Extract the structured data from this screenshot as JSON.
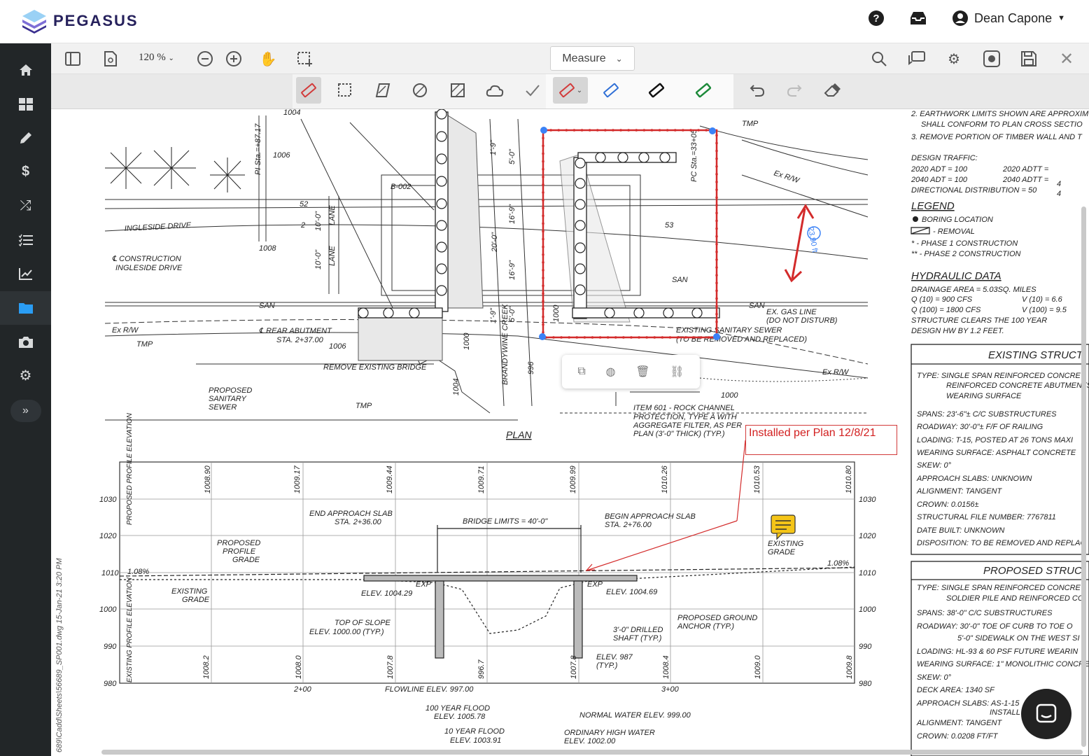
{
  "app": {
    "name": "PEGASUS",
    "user": "Dean Capone"
  },
  "sidebar": {
    "items": [
      "home-icon",
      "dashboard-icon",
      "pencil-icon",
      "dollar-icon",
      "shuffle-icon",
      "checklist-icon",
      "chart-icon",
      "folder-icon",
      "camera-icon",
      "gear-icon"
    ],
    "active": "folder-icon"
  },
  "toolbar": {
    "zoom": "120 %",
    "mode": "Measure"
  },
  "annotation": {
    "note_text": "Installed per Plan 12/8/21",
    "measure_label": "23.90 ft"
  },
  "drawing": {
    "file_path": "689\\Cadd\\Sheets\\56689_SP001.dwg  15-Jan-21  3:20 PM",
    "plan_title": "PLAN",
    "plan_labels": {
      "sta_1004": "1004",
      "pi_sta": "PI Sta.=+87.17",
      "label_1006": "1006",
      "b002": "B-002",
      "ingleside": "INGLESIDE DRIVE",
      "label_1008": "1008",
      "construction": "℄ CONSTRUCTION",
      "ingleside2": "INGLESIDE DRIVE",
      "pc_sta": "PC Sta.=33+05",
      "tmp": "TMP",
      "exrw": "Ex R/W",
      "san": "SAN",
      "lane": "LANE",
      "rear_abutment": "℄ REAR ABUTMENT",
      "rear_sta": "STA. 2+37.00",
      "remove_bridge": "REMOVE EXISTING BRIDGE",
      "proposed_sanitary": "PROPOSED",
      "sanitary2": "SANITARY",
      "sewer": "SEWER",
      "gas_line": "EX. GAS LINE",
      "gas_note": "(DO NOT DISTURB)",
      "existing_sewer": "EXISTING SANITARY SEWER",
      "sewer_note": "(TO BE REMOVED AND REPLACED)",
      "brandywine": "BRANDYWINE CREEK",
      "item601": "ITEM 601 - ROCK CHANNEL",
      "item601b": "PROTECTION, TYPE A WITH",
      "item601c": "AGGREGATE FILTER, AS PER",
      "item601d": "PLAN (3'-0\" THICK) (TYP.)",
      "l1000": "1000",
      "l996": "996",
      "l53": "53",
      "l52": "52",
      "l2": "2",
      "dim_10_0": "10'-0\"",
      "dim_20_0": "20'-0\"",
      "dim_16_9": "16'-9\"",
      "dim_5_0": "5'-0\"",
      "dim_1_9": "1'-9\""
    },
    "profile": {
      "top_values": [
        "1008.90",
        "1009.17",
        "1009.44",
        "1009.71",
        "1009.99",
        "1010.26",
        "1010.53",
        "1010.80"
      ],
      "bottom_values": [
        "1008.2",
        "1008.0",
        "1007.8",
        "996.7",
        "1007.8",
        "1008.4",
        "1009.0",
        "1009.8"
      ],
      "elev_left": [
        "1030",
        "1020",
        "1010",
        "1000",
        "990",
        "980"
      ],
      "elev_right": [
        "1030",
        "1020",
        "1010",
        "1000",
        "990",
        "980"
      ],
      "stations": [
        "2+00",
        "3+00"
      ],
      "prop_label": "PROPOSED PROFILE ELEVATION",
      "exist_label": "EXISTING PROFILE ELEVATION",
      "end_slab": "END APPROACH SLAB",
      "end_slab_sta": "STA. 2+36.00",
      "begin_slab": "BEGIN APPROACH SLAB",
      "begin_slab_sta": "STA. 2+76.00",
      "bridge_limits": "BRIDGE LIMITS = 40'-0\"",
      "prop_grade": "PROPOSED",
      "prop_grade2": "PROFILE",
      "prop_grade3": "GRADE",
      "exist_grade": "EXISTING",
      "exist_grade2": "GRADE",
      "grade_left": "1.08%",
      "grade_right": "1.08%",
      "exp1": "EXP",
      "exp2": "EXP",
      "elev_1004_29": "ELEV. 1004.29",
      "elev_1004_69": "ELEV. 1004.69",
      "top_slope": "TOP OF SLOPE",
      "top_slope2": "ELEV. 1000.00 (TYP.)",
      "ground_anchor": "PROPOSED GROUND",
      "ground_anchor2": "ANCHOR (TYP.)",
      "drilled": "3'-0\" DRILLED",
      "drilled2": "SHAFT (TYP.)",
      "elev987": "ELEV. 987",
      "elev987b": "(TYP.)",
      "flowline": "FLOWLINE ELEV. 997.00",
      "flood100": "100 YEAR FLOOD",
      "flood100b": "ELEV. 1005.78",
      "normal_water": "NORMAL WATER ELEV. 999.00",
      "flood10": "10 YEAR FLOOD",
      "flood10b": "ELEV. 1003.91",
      "ohw": "ORDINARY HIGH WATER",
      "ohw2": "ELEV. 1002.00"
    },
    "notes": {
      "n2": "2. EARTHWORK LIMITS SHOWN ARE APPROXIM",
      "n2b": "SHALL CONFORM TO PLAN CROSS SECTIO",
      "n3": "3. REMOVE PORTION OF TIMBER WALL AND T",
      "design_traffic": "DESIGN TRAFFIC:",
      "adt2020": "2020 ADT = 100",
      "adtt2020": "2020 ADTT =",
      "adt2040": "2040 ADT = 100",
      "adtt2040": "2040 ADTT =",
      "dd": "DIRECTIONAL DISTRIBUTION = 50",
      "four1": "4",
      "four2": "4",
      "legend": "LEGEND",
      "boring": "BORING LOCATION",
      "removal": "- REMOVAL",
      "phase1": "* - PHASE 1 CONSTRUCTION",
      "phase2": "** - PHASE 2 CONSTRUCTION",
      "hydraulic": "HYDRAULIC DATA",
      "drainage": "DRAINAGE AREA = 5.03SQ. MILES",
      "q10": "Q (10) = 900 CFS",
      "v10": "V (10) = 6.6",
      "q100": "Q (100) = 1800 CFS",
      "v100": "V (100) = 9.5",
      "clears": "STRUCTURE CLEARS THE 100 YEAR",
      "design_hw": "DESIGN HW BY 1.2 FEET.",
      "existing_struct": "EXISTING STRUCT",
      "e_type": "TYPE: SINGLE SPAN REINFORCED CONCRET",
      "e_type2": "REINFORCED CONCRETE ABUTMENTS",
      "e_type3": "WEARING SURFACE",
      "e_spans": "SPANS: 23'-6\"± C/C SUBSTRUCTURES",
      "e_roadway": "ROADWAY: 30'-0\"± F/F OF RAILING",
      "e_loading": "LOADING: T-15, POSTED AT 26 TONS MAXI",
      "e_wearing": "WEARING SURFACE: ASPHALT CONCRETE",
      "e_skew": "SKEW: 0°",
      "e_approach": "APPROACH SLABS: UNKNOWN",
      "e_alignment": "ALIGNMENT: TANGENT",
      "e_crown": "CROWN: 0.0156±",
      "e_file": "STRUCTURAL FILE NUMBER: 7767811",
      "e_date": "DATE BUILT: UNKNOWN",
      "e_disp": "DISPOSITION: TO BE REMOVED AND REPLAC",
      "proposed_struct": "PROPOSED STRUC",
      "p_type": "TYPE: SINGLE SPAN REINFORCED CONCRET",
      "p_type2": "SOLDIER PILE AND REINFORCED CO",
      "p_spans": "SPANS: 38'-0\" C/C SUBSTRUCTURES",
      "p_roadway": "ROADWAY: 30'-0\" TOE OF CURB TO TOE O",
      "p_roadway2": "5'-0\" SIDEWALK ON THE WEST SI",
      "p_loading": "LOADING: HL-93 & 60 PSF FUTURE WEARIN",
      "p_wearing": "WEARING SURFACE: 1\" MONOLITHIC CONCRE",
      "p_skew": "SKEW: 0°",
      "p_deck": "DECK AREA: 1340 SF",
      "p_approach": "APPROACH SLABS: AS-1-15",
      "p_install": "INSTALL",
      "p_alignment": "ALIGNMENT: TANGENT",
      "p_crown": "CROWN: 0.0208 FT/FT"
    }
  }
}
